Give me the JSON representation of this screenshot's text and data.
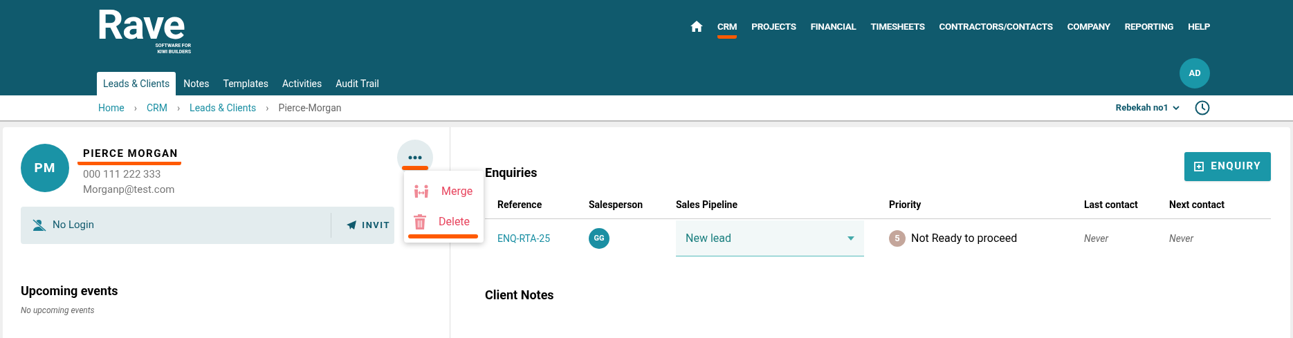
{
  "logo": {
    "wordmark": "Rave",
    "tagline_1": "SOFTWARE FOR",
    "tagline_2": "KIWI BUILDERS"
  },
  "nav": [
    {
      "label": "CRM",
      "selected": true
    },
    {
      "label": "PROJECTS",
      "selected": false
    },
    {
      "label": "FINANCIAL",
      "selected": false
    },
    {
      "label": "TIMESHEETS",
      "selected": false
    },
    {
      "label": "CONTRACTORS/CONTACTS",
      "selected": false
    },
    {
      "label": "COMPANY",
      "selected": false
    },
    {
      "label": "REPORTING",
      "selected": false
    },
    {
      "label": "HELP",
      "selected": false
    }
  ],
  "user_avatar": "AD",
  "tabs": [
    {
      "label": "Leads & Clients",
      "selected": true
    },
    {
      "label": "Notes",
      "selected": false
    },
    {
      "label": "Templates",
      "selected": false
    },
    {
      "label": "Activities",
      "selected": false
    },
    {
      "label": "Audit Trail",
      "selected": false
    }
  ],
  "breadcrumb": [
    {
      "label": "Home",
      "link": true
    },
    {
      "separator": "›",
      "label": "CRM",
      "link": true
    },
    {
      "separator": "›",
      "label": "Leads & Clients",
      "link": true
    },
    {
      "separator": "›",
      "label": "Pierce-Morgan",
      "link": false
    }
  ],
  "account": "Rebekah no1",
  "client": {
    "initials": "PM",
    "name": "PIERCE MORGAN",
    "name_highlighted": true,
    "phone": "000 111 222 333",
    "email": "Morganp@test.com"
  },
  "more_button": {
    "highlighted": true
  },
  "menu": [
    {
      "label": "Merge",
      "kind": "merge",
      "highlighted": false
    },
    {
      "label": "Delete",
      "kind": "delete",
      "highlighted": true
    }
  ],
  "login_bar": {
    "status": "No Login",
    "action": "INVIT"
  },
  "upcoming": {
    "title": "Upcoming events",
    "empty": "No upcoming events"
  },
  "enquiries": {
    "title": "Enquiries",
    "button": "ENQUIRY",
    "columns": [
      "Reference",
      "Salesperson",
      "Sales Pipeline",
      "Priority",
      "Last contact",
      "Next contact"
    ],
    "rows": [
      {
        "reference": "ENQ-RTA-25",
        "salesperson": "GG",
        "pipeline": "New lead",
        "priority_level": "5",
        "priority": "Not Ready to proceed",
        "last_contact": "Never",
        "next_contact": "Never"
      }
    ]
  },
  "client_notes": {
    "title": "Client Notes"
  }
}
